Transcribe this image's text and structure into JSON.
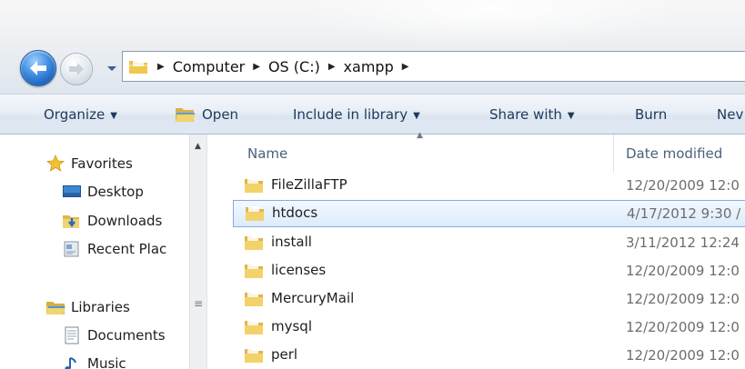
{
  "address_bar": {
    "crumbs": [
      "Computer",
      "OS (C:)",
      "xampp"
    ]
  },
  "toolbar": {
    "organize": "Organize",
    "open": "Open",
    "include_in_library": "Include in library",
    "share_with": "Share with",
    "burn": "Burn",
    "new_folder": "Nev"
  },
  "nav_pane": {
    "favorites": "Favorites",
    "desktop": "Desktop",
    "downloads": "Downloads",
    "recent_places": "Recent Plac",
    "libraries": "Libraries",
    "documents": "Documents",
    "music": "Music"
  },
  "file_list": {
    "columns": {
      "name": "Name",
      "date_modified": "Date modified"
    },
    "rows": [
      {
        "name": "FileZillaFTP",
        "date": "12/20/2009 12:0",
        "selected": false
      },
      {
        "name": "htdocs",
        "date": "4/17/2012 9:30 /",
        "selected": true
      },
      {
        "name": "install",
        "date": "3/11/2012 12:24",
        "selected": false
      },
      {
        "name": "licenses",
        "date": "12/20/2009 12:0",
        "selected": false
      },
      {
        "name": "MercuryMail",
        "date": "12/20/2009 12:0",
        "selected": false
      },
      {
        "name": "mysql",
        "date": "12/20/2009 12:0",
        "selected": false
      },
      {
        "name": "perl",
        "date": "12/20/2009 12:0",
        "selected": false
      }
    ]
  },
  "icons": {
    "back": "back-arrow-icon",
    "forward": "forward-arrow-icon",
    "folder": "folder-icon",
    "star": "star-icon",
    "desktop": "desktop-icon",
    "downloads": "downloads-icon",
    "recent": "recent-places-icon",
    "library": "library-icon",
    "documents": "documents-icon",
    "music": "music-icon"
  },
  "colors": {
    "selection_border": "#84acdd",
    "toolbar_text": "#1e395b",
    "header_text": "#4c607a",
    "date_text": "#6d6d6d"
  }
}
